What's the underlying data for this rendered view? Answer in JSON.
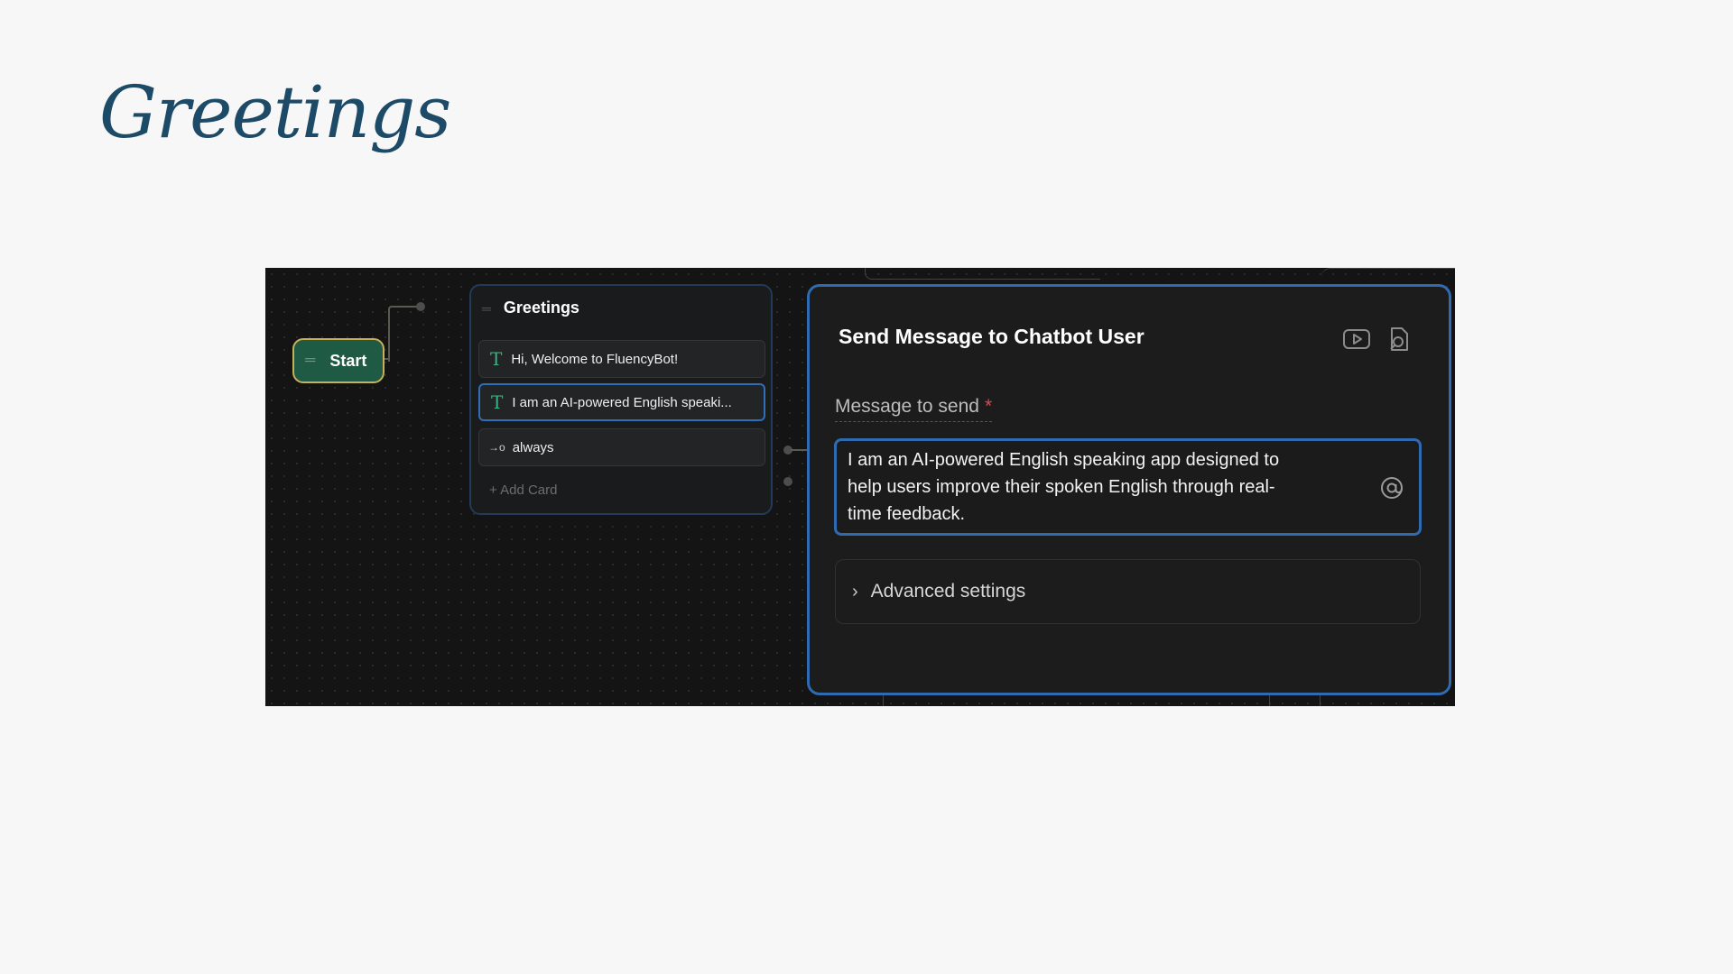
{
  "slide": {
    "title": "Greetings"
  },
  "flow": {
    "start_label": "Start",
    "group": {
      "title": "Greetings",
      "cards": [
        {
          "icon": "T",
          "label": "Hi, Welcome to FluencyBot!",
          "selected": false
        },
        {
          "icon": "T",
          "label": "I am an AI-powered English speaki...",
          "selected": true
        },
        {
          "icon": "→o",
          "label": "always",
          "selected": false
        }
      ],
      "add_card_label": "+ Add Card"
    }
  },
  "panel": {
    "title": "Send Message to Chatbot User",
    "field_label": "Message to send",
    "required_mark": "*",
    "message_value": "I am an AI-powered English speaking app designed to\n help users improve their spoken English through real-\ntime feedback.",
    "advanced_label": "Advanced settings"
  },
  "colors": {
    "title": "#1d4a66",
    "canvas_bg": "#141414",
    "start_node": "#1f5a44",
    "start_border": "#c9b056",
    "accent_blue": "#2f6bb0",
    "text_icon_green": "#39b37f"
  }
}
